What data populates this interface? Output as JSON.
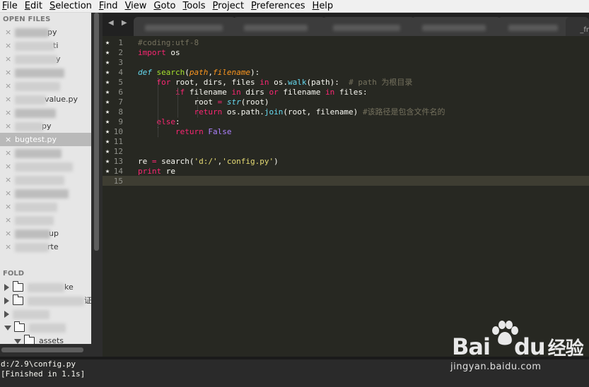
{
  "menu": [
    {
      "label": "File",
      "ul": "F",
      "rest": "ile"
    },
    {
      "label": "Edit",
      "ul": "E",
      "rest": "dit"
    },
    {
      "label": "Selection",
      "ul": "S",
      "rest": "election"
    },
    {
      "label": "Find",
      "ul": "F",
      "rest": "ind"
    },
    {
      "label": "View",
      "ul": "V",
      "rest": "iew"
    },
    {
      "label": "Goto",
      "ul": "G",
      "rest": "oto"
    },
    {
      "label": "Tools",
      "ul": "T",
      "rest": "ools"
    },
    {
      "label": "Project",
      "ul": "P",
      "rest": "roject"
    },
    {
      "label": "Preferences",
      "ul": "P",
      "rest": "references"
    },
    {
      "label": "Help",
      "ul": "H",
      "rest": "elp"
    }
  ],
  "sidebar": {
    "open_files_header": "OPEN FILES",
    "close_glyph": "×",
    "files": [
      {
        "suffix": "py"
      },
      {
        "suffix": "ti"
      },
      {
        "suffix": "y"
      },
      {
        "suffix": ""
      },
      {
        "suffix": ""
      },
      {
        "suffix": "value.py"
      },
      {
        "suffix": ""
      },
      {
        "suffix": "py"
      },
      {
        "suffix": "bugtest.py",
        "active": true
      },
      {
        "suffix": ""
      },
      {
        "suffix": ""
      },
      {
        "suffix": ""
      },
      {
        "suffix": ""
      },
      {
        "suffix": ""
      },
      {
        "suffix": ""
      },
      {
        "suffix": "up"
      },
      {
        "suffix": "rte"
      }
    ],
    "folders_header": "FOLD",
    "folders": [
      {
        "suffix": "ke"
      },
      {
        "suffix": "证"
      },
      {
        "suffix": ""
      },
      {
        "suffix": ""
      },
      {
        "name": "assets"
      }
    ]
  },
  "tabbar": {
    "nav_glyphs": "◀ ▶",
    "last_tab_label": "_fr"
  },
  "editor": {
    "star": "★",
    "line_numbers": [
      "1",
      "2",
      "3",
      "4",
      "5",
      "6",
      "7",
      "8",
      "9",
      "10",
      "11",
      "12",
      "13",
      "14",
      "15"
    ],
    "lines": [
      [
        {
          "t": "#coding:utf-8",
          "c": "c-com"
        }
      ],
      [
        {
          "t": "import",
          "c": "c-kw"
        },
        {
          "t": " os"
        }
      ],
      [],
      [
        {
          "t": "def",
          "c": "c-fn"
        },
        {
          "t": " "
        },
        {
          "t": "search",
          "c": "c-def"
        },
        {
          "t": "("
        },
        {
          "t": "path",
          "c": "c-par"
        },
        {
          "t": ","
        },
        {
          "t": "filename",
          "c": "c-par"
        },
        {
          "t": "):"
        }
      ],
      [
        {
          "t": "    "
        },
        {
          "t": "for",
          "c": "c-kw"
        },
        {
          "t": " root, dirs, files "
        },
        {
          "t": "in",
          "c": "c-kw"
        },
        {
          "t": " os."
        },
        {
          "t": "walk",
          "c": "c-call"
        },
        {
          "t": "(path):  "
        },
        {
          "t": "# path 为根目录",
          "c": "c-com"
        }
      ],
      [
        {
          "t": "        "
        },
        {
          "t": "if",
          "c": "c-kw"
        },
        {
          "t": " filename "
        },
        {
          "t": "in",
          "c": "c-kw"
        },
        {
          "t": " dirs "
        },
        {
          "t": "or",
          "c": "c-kw"
        },
        {
          "t": " filename "
        },
        {
          "t": "in",
          "c": "c-kw"
        },
        {
          "t": " files:"
        }
      ],
      [
        {
          "t": "            root "
        },
        {
          "t": "=",
          "c": "c-kw"
        },
        {
          "t": " "
        },
        {
          "t": "str",
          "c": "c-fn"
        },
        {
          "t": "(root)"
        }
      ],
      [
        {
          "t": "            "
        },
        {
          "t": "return",
          "c": "c-kw"
        },
        {
          "t": " os.path."
        },
        {
          "t": "join",
          "c": "c-call"
        },
        {
          "t": "(root, filename) "
        },
        {
          "t": "#该路径是包含文件名的",
          "c": "c-com"
        }
      ],
      [
        {
          "t": "    "
        },
        {
          "t": "else",
          "c": "c-kw"
        },
        {
          "t": ":"
        }
      ],
      [
        {
          "t": "        "
        },
        {
          "t": "return",
          "c": "c-kw"
        },
        {
          "t": " "
        },
        {
          "t": "False",
          "c": "c-const"
        }
      ],
      [],
      [],
      [
        {
          "t": "re "
        },
        {
          "t": "=",
          "c": "c-kw"
        },
        {
          "t": " search("
        },
        {
          "t": "'d:/'",
          "c": "c-str"
        },
        {
          "t": ","
        },
        {
          "t": "'config.py'",
          "c": "c-str"
        },
        {
          "t": ")"
        }
      ],
      [
        {
          "t": "print",
          "c": "c-kw"
        },
        {
          "t": " re"
        }
      ],
      []
    ],
    "starred_lines": 14
  },
  "output": {
    "lines": [
      "d:/2.9\\config.py",
      "[Finished in 1.1s]"
    ]
  },
  "watermark": {
    "brand_a": "Bai",
    "brand_b": "du",
    "brand_c": "经验",
    "url": "jingyan.baidu.com"
  }
}
